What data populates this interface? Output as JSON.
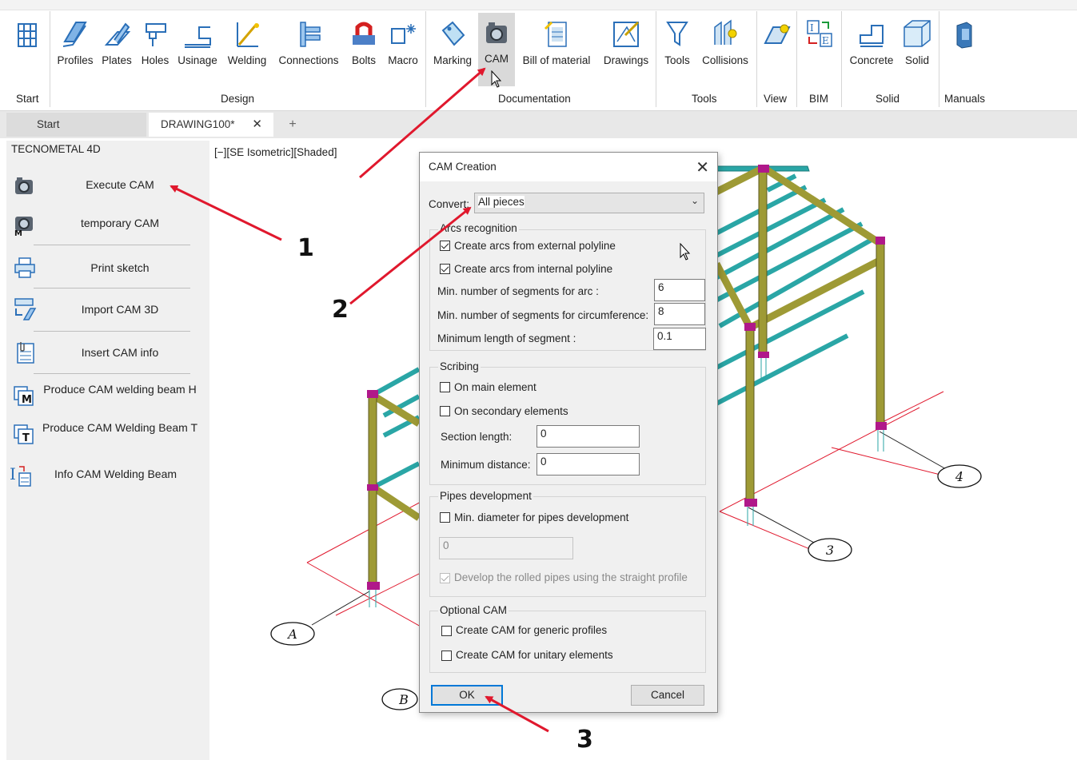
{
  "ribbon": {
    "design_buttons": [
      {
        "label": "Profiles",
        "icon": "profiles-icon"
      },
      {
        "label": "Plates",
        "icon": "plates-icon"
      },
      {
        "label": "Holes",
        "icon": "holes-icon"
      },
      {
        "label": "Usinage",
        "icon": "usinage-icon"
      },
      {
        "label": "Welding",
        "icon": "welding-icon"
      },
      {
        "label": "Connections",
        "icon": "connections-icon"
      },
      {
        "label": "Bolts",
        "icon": "bolts-icon"
      },
      {
        "label": "Macro",
        "icon": "macro-icon"
      }
    ],
    "documentation_buttons": [
      {
        "label": "Marking",
        "icon": "marking-icon"
      },
      {
        "label": "CAM",
        "icon": "cam-icon"
      },
      {
        "label": "Bill of material",
        "icon": "bill-of-material-icon"
      },
      {
        "label": "Drawings",
        "icon": "drawings-icon"
      }
    ],
    "tools_buttons": [
      {
        "label": "Tools",
        "icon": "funnel-icon"
      },
      {
        "label": "Collisions",
        "icon": "collisions-icon"
      }
    ],
    "solid_buttons": [
      {
        "label": "Concrete",
        "icon": "concrete-icon"
      },
      {
        "label": "Solid",
        "icon": "solid-cube-icon"
      }
    ],
    "groups": {
      "start": "Start",
      "design": "Design",
      "documentation": "Documentation",
      "tools": "Tools",
      "view": "View",
      "bim": "BIM",
      "solid": "Solid",
      "manuals": "Manuals"
    }
  },
  "tabs": {
    "start": "Start",
    "drawing": "DRAWING100*",
    "close": "✕",
    "add": "+"
  },
  "panel": {
    "title": "TECNOMETAL 4D",
    "items": [
      {
        "label": "Execute CAM",
        "icon": "camera-icon"
      },
      {
        "label": "temporary CAM",
        "icon": "temporary-cam-icon"
      },
      {
        "label": "Print sketch",
        "icon": "printer-icon"
      },
      {
        "label": "Import CAM 3D",
        "icon": "import-cam-icon"
      },
      {
        "label": "Insert CAM info",
        "icon": "document-clip-icon"
      },
      {
        "label": "Produce CAM welding beam H",
        "icon": "weld-beam-h-icon"
      },
      {
        "label": "Produce CAM Welding Beam T",
        "icon": "weld-beam-t-icon"
      },
      {
        "label": "Info CAM Welding Beam",
        "icon": "info-weld-beam-icon"
      }
    ]
  },
  "viewport": {
    "label": "[−][SE Isometric][Shaded]",
    "axis_labels": [
      "4",
      "3",
      "A",
      "B"
    ]
  },
  "dialog": {
    "title": "CAM Creation",
    "close": "✕",
    "convert_label": "Convert:",
    "convert_value": "All pieces",
    "arcs": {
      "legend": "Arcs recognition",
      "external": "Create arcs from external polyline",
      "internal": "Create arcs from internal polyline",
      "min_segments_arc_label": "Min. number of segments for arc :",
      "min_segments_arc_value": "6",
      "min_segments_circ_label": "Min. number of segments for circumference:",
      "min_segments_circ_value": "8",
      "min_length_label": "Minimum length of segment :",
      "min_length_value": "0.1"
    },
    "scribing": {
      "legend": "Scribing",
      "main": "On main element",
      "secondary": "On secondary elements",
      "section_length_label": "Section length:",
      "section_length_value": "0",
      "min_distance_label": "Minimum distance:",
      "min_distance_value": "0"
    },
    "pipes": {
      "legend": "Pipes development",
      "min_diameter": "Min. diameter for pipes development",
      "diameter_value": "0",
      "rolled": "Develop the rolled pipes using the straight profile"
    },
    "optional": {
      "legend": "Optional CAM",
      "generic": "Create CAM for generic profiles",
      "unitary": "Create CAM for unitary elements"
    },
    "ok": "OK",
    "cancel": "Cancel"
  },
  "annotations": {
    "step1": "1",
    "step2": "2",
    "step3": "3",
    "arrow_color": "#e0182d"
  },
  "colors": {
    "beam_yellow": "#9e9a35",
    "purlin_teal": "#2aa6a6",
    "axis_red": "#e0182d",
    "dialog_bg": "#f0f0f0",
    "accent_blue": "#0078d7"
  }
}
